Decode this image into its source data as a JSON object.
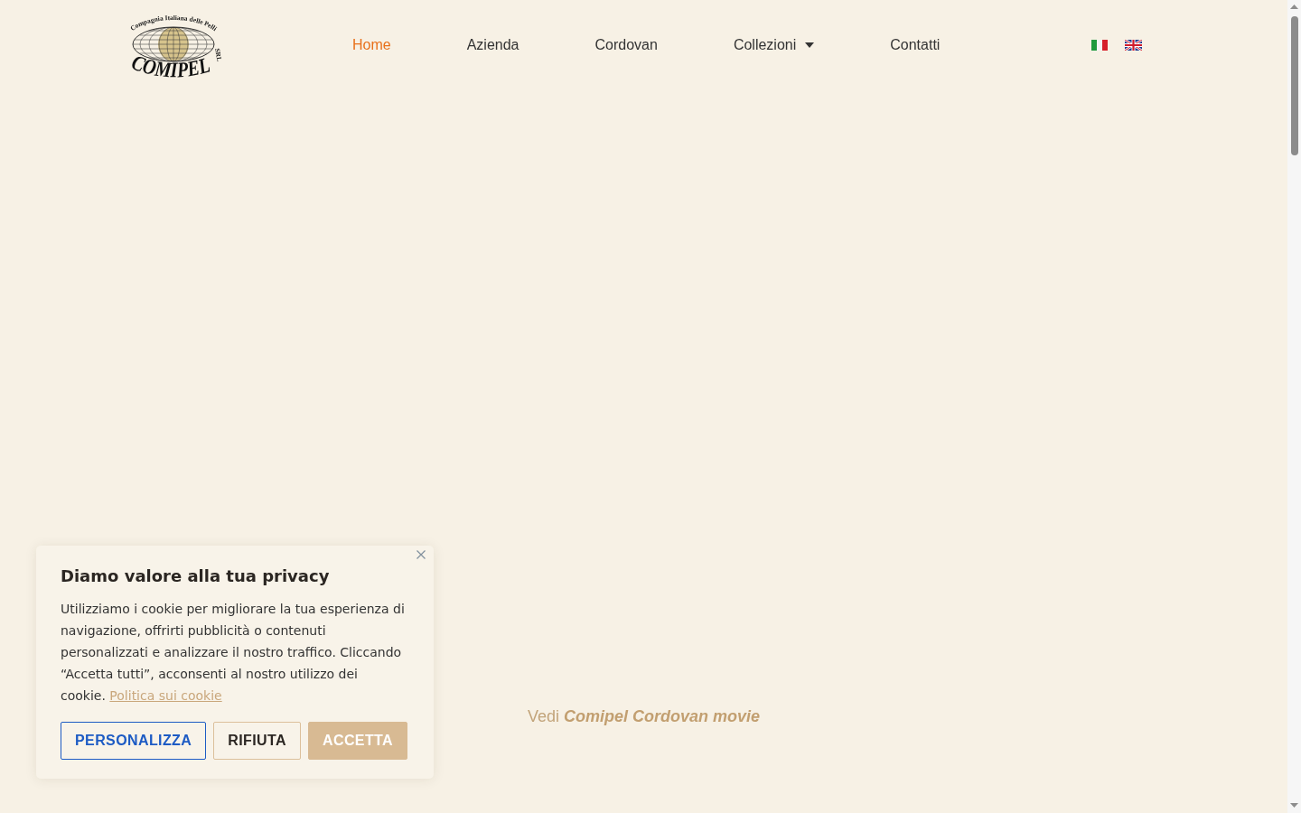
{
  "header": {
    "logo": {
      "tagline": "Compagnia Italiana delle Pelli",
      "name": "COMIPEL",
      "suffix": "SRL"
    },
    "nav": [
      {
        "label": "Home",
        "selected": true,
        "submenu": false
      },
      {
        "label": "Azienda",
        "selected": false,
        "submenu": false
      },
      {
        "label": "Cordovan",
        "selected": false,
        "submenu": false
      },
      {
        "label": "Collezioni",
        "selected": false,
        "submenu": true
      },
      {
        "label": "Contatti",
        "selected": false,
        "submenu": false
      }
    ],
    "languages": [
      {
        "kind": "it"
      },
      {
        "kind": "en"
      }
    ]
  },
  "hero": {
    "link": "Vedi **Comipel Cordovan movie**"
  },
  "cookie_banner": {
    "title": "Diamo valore alla tua privacy",
    "text": "Utilizziamo i cookie per migliorare la tua esperienza di navigazione, offrirti pubblicità o contenuti personalizzati e analizzare il nostro traffico. Cliccando “Accetta tutti”, acconsenti al nostro utilizzo dei cookie.",
    "link": "Politica sui cookie",
    "buttons": [
      {
        "label": "PERSONALIZZA",
        "kind": "outline"
      },
      {
        "label": "RIFIUTA",
        "kind": "secondary"
      },
      {
        "label": "ACCETTA",
        "kind": "primary"
      }
    ]
  }
}
